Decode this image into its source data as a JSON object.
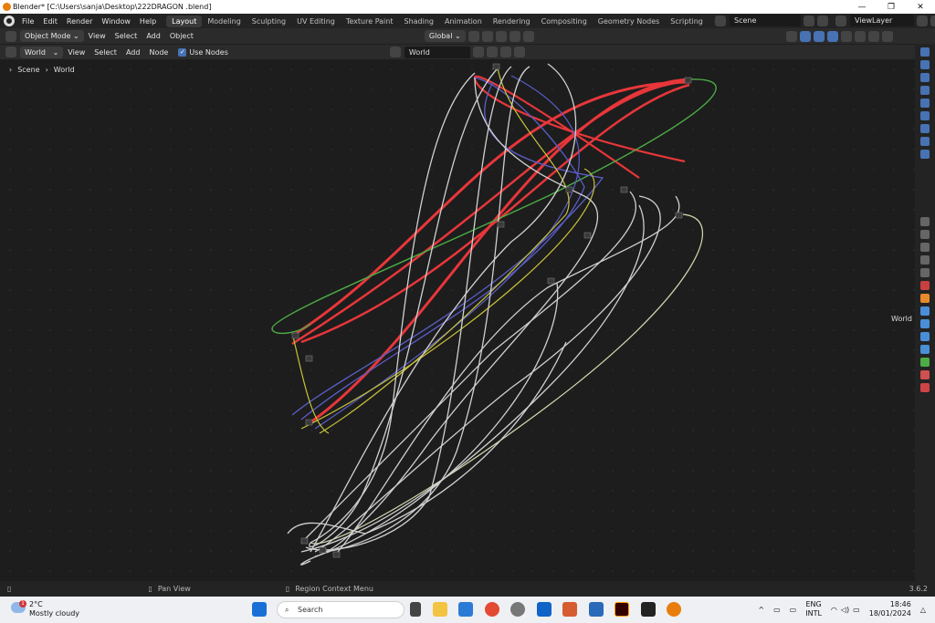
{
  "window": {
    "title": "Blender* [C:\\Users\\sanja\\Desktop\\222DRAGON .blend]",
    "minimize": "—",
    "maximize": "❐",
    "close": "✕"
  },
  "menu": [
    "File",
    "Edit",
    "Render",
    "Window",
    "Help"
  ],
  "workspaces": [
    "Layout",
    "Modeling",
    "Sculpting",
    "UV Editing",
    "Texture Paint",
    "Shading",
    "Animation",
    "Rendering",
    "Compositing",
    "Geometry Nodes",
    "Scripting",
    "+"
  ],
  "active_workspace": "Layout",
  "scene": {
    "name": "Scene",
    "view_layer": "ViewLayer"
  },
  "header1": {
    "mode": "Object Mode",
    "view": "View",
    "select": "Select",
    "add": "Add",
    "object": "Object",
    "transform": "Global"
  },
  "header2": {
    "shader_type": "World",
    "view": "View",
    "select": "Select",
    "add": "Add",
    "node": "Node",
    "use_nodes": "Use Nodes",
    "datablock": "World"
  },
  "breadcrumb": {
    "scene": "Scene",
    "world": "World"
  },
  "side_label": "World",
  "statusbar": {
    "action": "Pan View",
    "context": "Region Context Menu",
    "version": "3.6.2"
  },
  "taskbar": {
    "temp": "2°C",
    "weather": "Mostly cloudy",
    "badge": "1",
    "search": "Search",
    "lang1": "ENG",
    "lang2": "INTL",
    "time": "18:46",
    "date": "18/01/2024"
  },
  "colors": {
    "red": "#e8363a",
    "green": "#4cad45",
    "blue": "#5a5ec8",
    "yellow": "#c8c23a",
    "white": "#d0d0d0",
    "cream": "#d8d8b0"
  }
}
